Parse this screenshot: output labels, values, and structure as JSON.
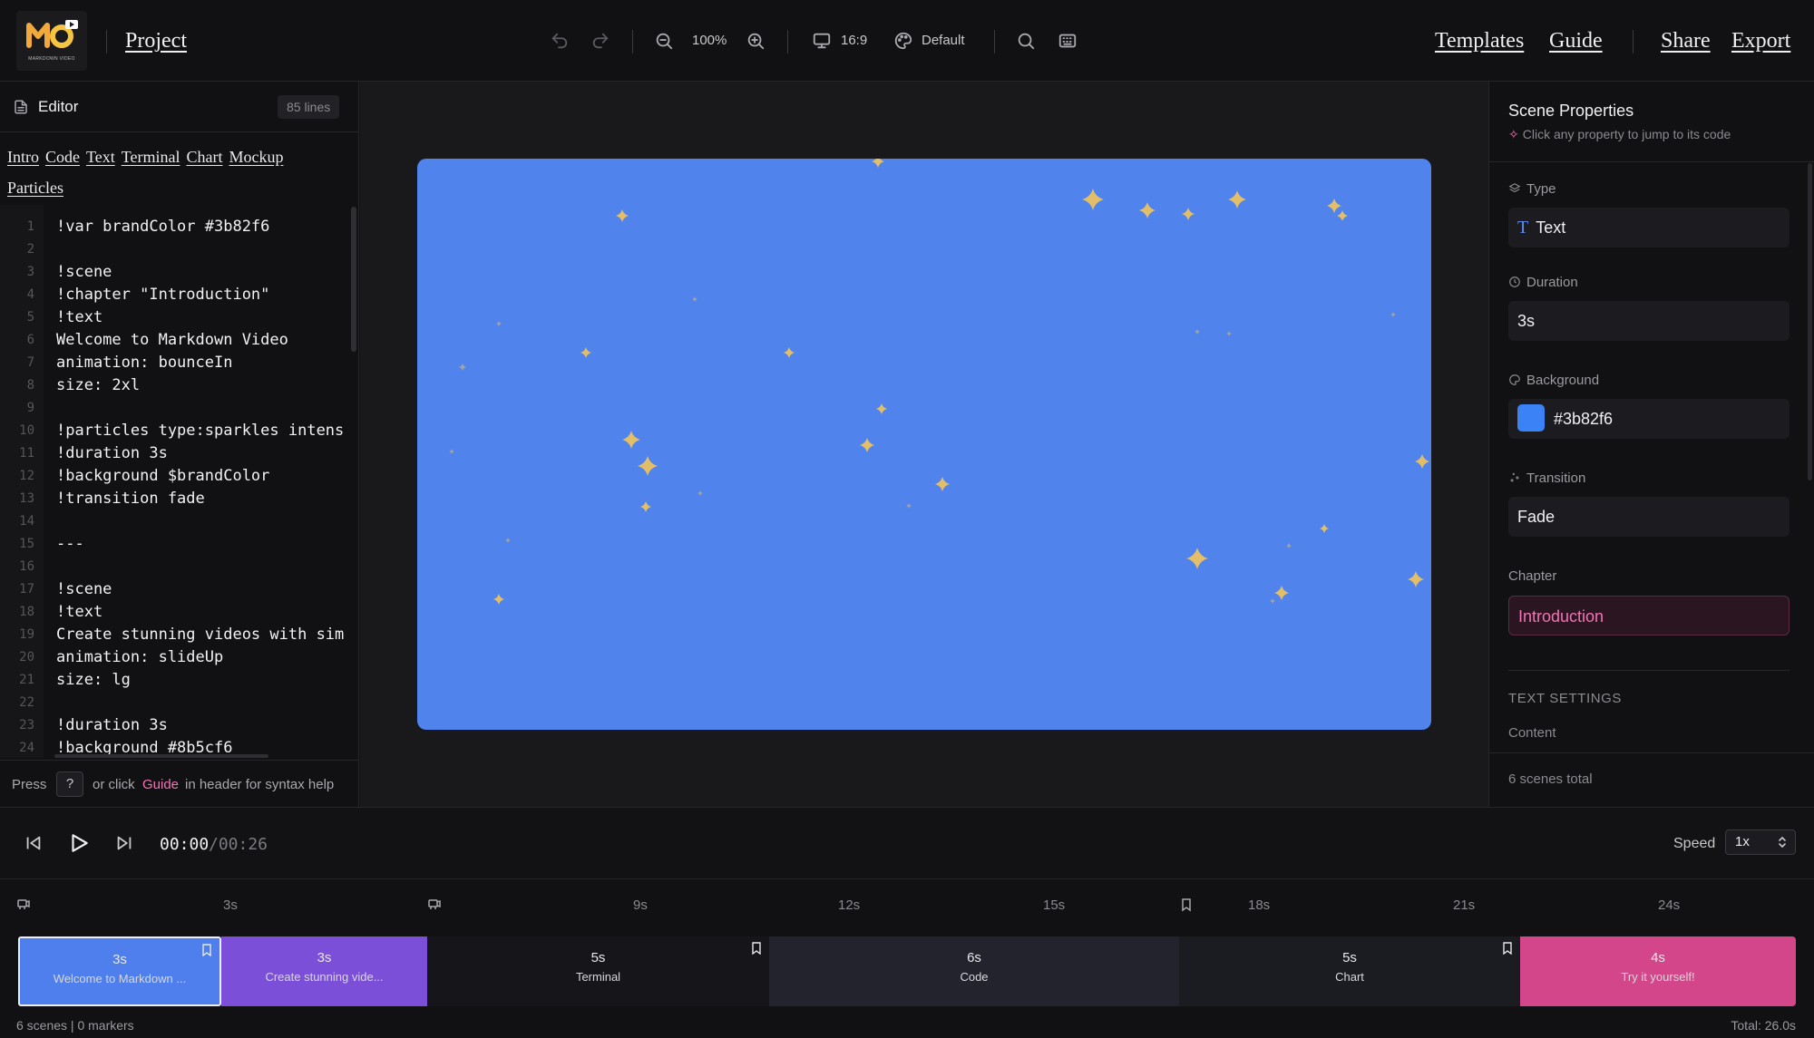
{
  "header": {
    "logo_text": "MARKDOWN VIDEO",
    "project_title": "Project",
    "zoom": "100%",
    "aspect_ratio": "16:9",
    "theme": "Default",
    "links": {
      "templates": "Templates",
      "guide": "Guide",
      "share": "Share",
      "export": "Export"
    }
  },
  "editor": {
    "title": "Editor",
    "lines_count": "85 lines",
    "snippets": [
      "Intro",
      "Code",
      "Text",
      "Terminal",
      "Chart",
      "Mockup",
      "Particles"
    ],
    "code_lines": [
      {
        "n": "1",
        "t": "!var brandColor #3b82f6"
      },
      {
        "n": "2",
        "t": ""
      },
      {
        "n": "3",
        "t": "!scene"
      },
      {
        "n": "4",
        "t": "!chapter \"Introduction\""
      },
      {
        "n": "5",
        "t": "!text"
      },
      {
        "n": "6",
        "t": "Welcome to Markdown Video"
      },
      {
        "n": "7",
        "t": "animation: bounceIn"
      },
      {
        "n": "8",
        "t": "size: 2xl"
      },
      {
        "n": "9",
        "t": ""
      },
      {
        "n": "10",
        "t": "!particles type:sparkles intens"
      },
      {
        "n": "11",
        "t": "!duration 3s"
      },
      {
        "n": "12",
        "t": "!background $brandColor"
      },
      {
        "n": "13",
        "t": "!transition fade"
      },
      {
        "n": "14",
        "t": ""
      },
      {
        "n": "15",
        "t": "---"
      },
      {
        "n": "16",
        "t": ""
      },
      {
        "n": "17",
        "t": "!scene"
      },
      {
        "n": "18",
        "t": "!text"
      },
      {
        "n": "19",
        "t": "Create stunning videos with sim"
      },
      {
        "n": "20",
        "t": "animation: slideUp"
      },
      {
        "n": "21",
        "t": "size: lg"
      },
      {
        "n": "22",
        "t": ""
      },
      {
        "n": "23",
        "t": "!duration 3s"
      },
      {
        "n": "24",
        "t": "!background #8b5cf6"
      }
    ],
    "help": {
      "press": "Press",
      "key": "?",
      "middle": "or click",
      "link": "Guide",
      "end": "in header for syntax help"
    }
  },
  "canvas": {
    "background_color": "#5183ed",
    "sparkle_color": "#f2c45a"
  },
  "properties": {
    "title": "Scene Properties",
    "hint": "Click any property to jump to its code",
    "type": {
      "label": "Type",
      "value": "Text"
    },
    "duration": {
      "label": "Duration",
      "value": "3s"
    },
    "background": {
      "label": "Background",
      "value": "#3b82f6"
    },
    "transition": {
      "label": "Transition",
      "value": "Fade"
    },
    "chapter": {
      "label": "Chapter",
      "value": "Introduction"
    },
    "section": "TEXT SETTINGS",
    "content_label": "Content",
    "footer": "6 scenes total"
  },
  "transport": {
    "current_time": "00:00",
    "total_time": "/00:26",
    "speed_label": "Speed",
    "speed_value": "1x"
  },
  "timeline": {
    "ticks": [
      "3s",
      "9s",
      "12s",
      "15s",
      "18s",
      "21s",
      "24s"
    ],
    "clips": [
      {
        "duration": "3s",
        "label": "Welcome to Markdown ...",
        "color": "#4f7fec"
      },
      {
        "duration": "3s",
        "label": "Create stunning vide...",
        "color": "#7b4fd8"
      },
      {
        "duration": "5s",
        "label": "Terminal",
        "color": "#16161a"
      },
      {
        "duration": "6s",
        "label": "Code",
        "color": "#23232e"
      },
      {
        "duration": "5s",
        "label": "Chart",
        "color": "#1b1b22"
      },
      {
        "duration": "4s",
        "label": "Try it yourself!",
        "color": "#d3478a"
      }
    ],
    "footer_left": "6 scenes | 0 markers",
    "footer_right": "Total: 26.0s"
  }
}
